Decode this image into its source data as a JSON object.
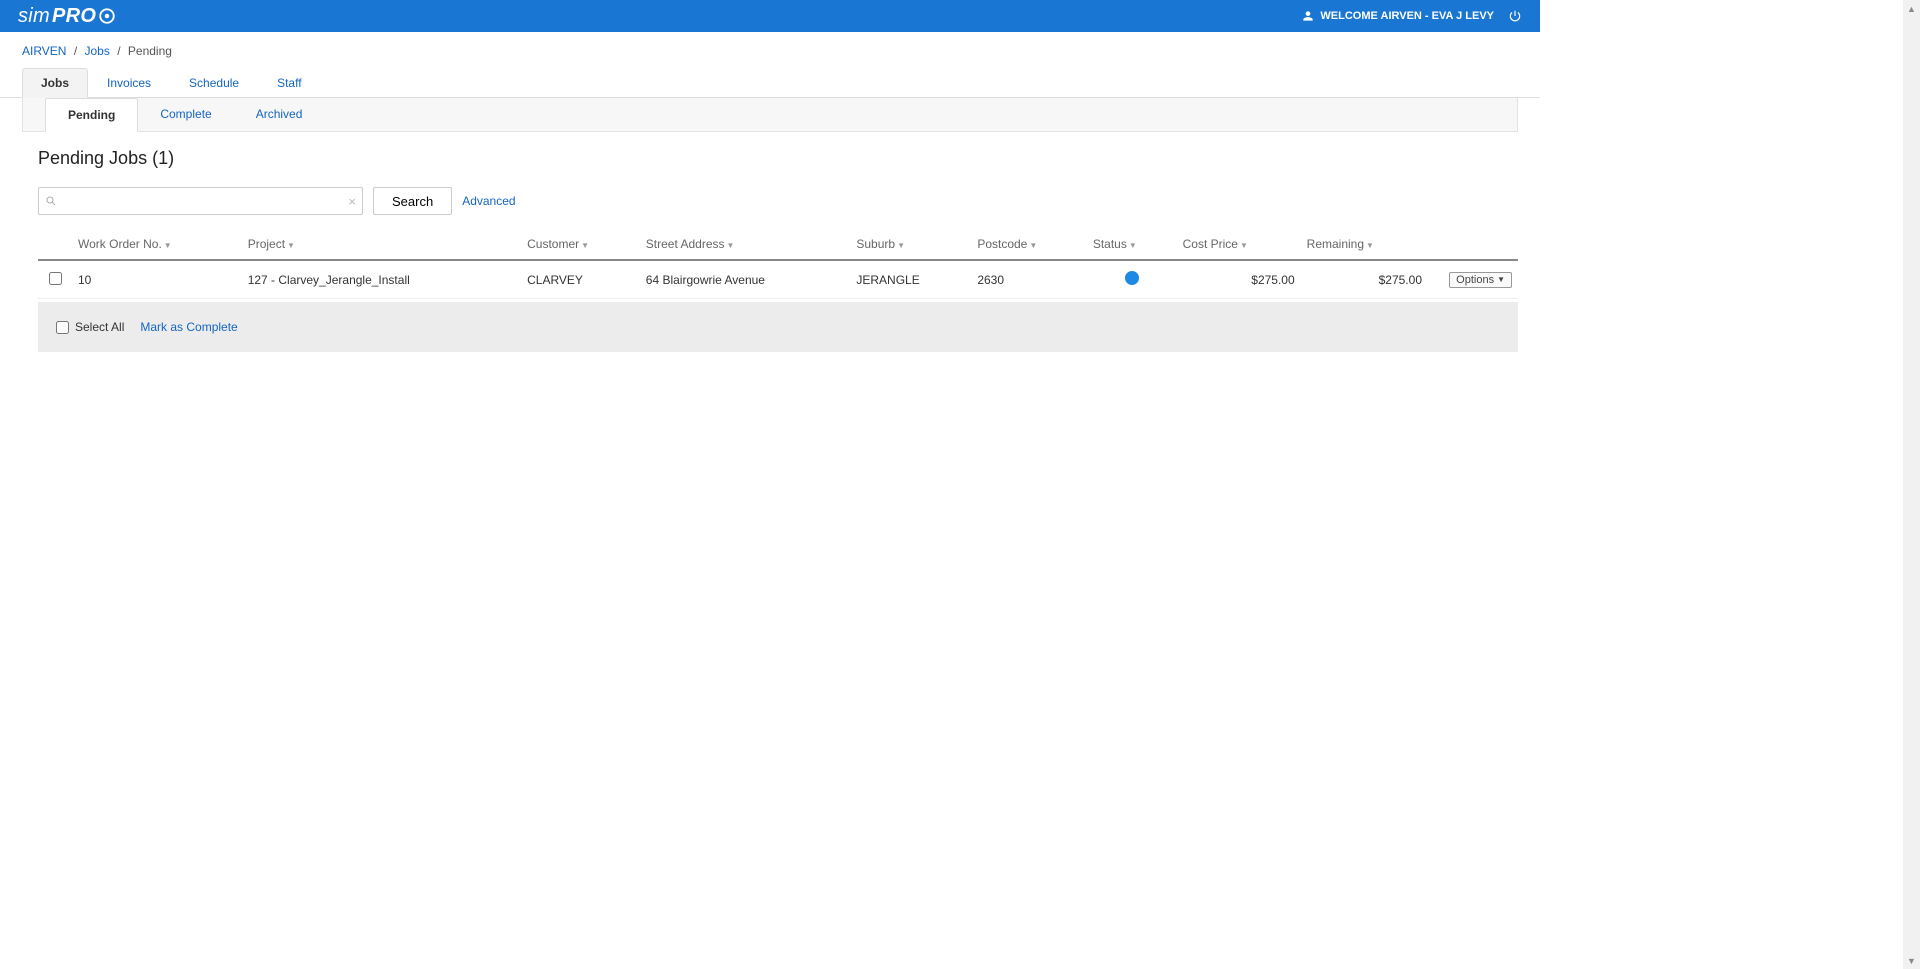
{
  "header": {
    "logo_sim": "sim",
    "logo_pro": "PRO",
    "welcome": "WELCOME AIRVEN - EVA J LEVY"
  },
  "breadcrumb": {
    "root": "AIRVEN",
    "jobs": "Jobs",
    "current": "Pending"
  },
  "tabs": {
    "jobs": "Jobs",
    "invoices": "Invoices",
    "schedule": "Schedule",
    "staff": "Staff"
  },
  "subtabs": {
    "pending": "Pending",
    "complete": "Complete",
    "archived": "Archived"
  },
  "page_title": "Pending Jobs (1)",
  "search": {
    "value": "",
    "button": "Search",
    "advanced": "Advanced"
  },
  "columns": {
    "work_order": "Work Order No.",
    "project": "Project",
    "customer": "Customer",
    "street": "Street Address",
    "suburb": "Suburb",
    "postcode": "Postcode",
    "status": "Status",
    "cost": "Cost Price",
    "remaining": "Remaining"
  },
  "rows": [
    {
      "work_order": "10",
      "project": "127 - Clarvey_Jerangle_Install",
      "customer": "CLARVEY",
      "street": "64 Blairgowrie Avenue",
      "suburb": "JERANGLE",
      "postcode": "2630",
      "status_color": "#1e88e5",
      "cost": "$275.00",
      "remaining": "$275.00",
      "options_label": "Options"
    }
  ],
  "footer": {
    "select_all": "Select All",
    "mark_complete": "Mark as Complete"
  }
}
